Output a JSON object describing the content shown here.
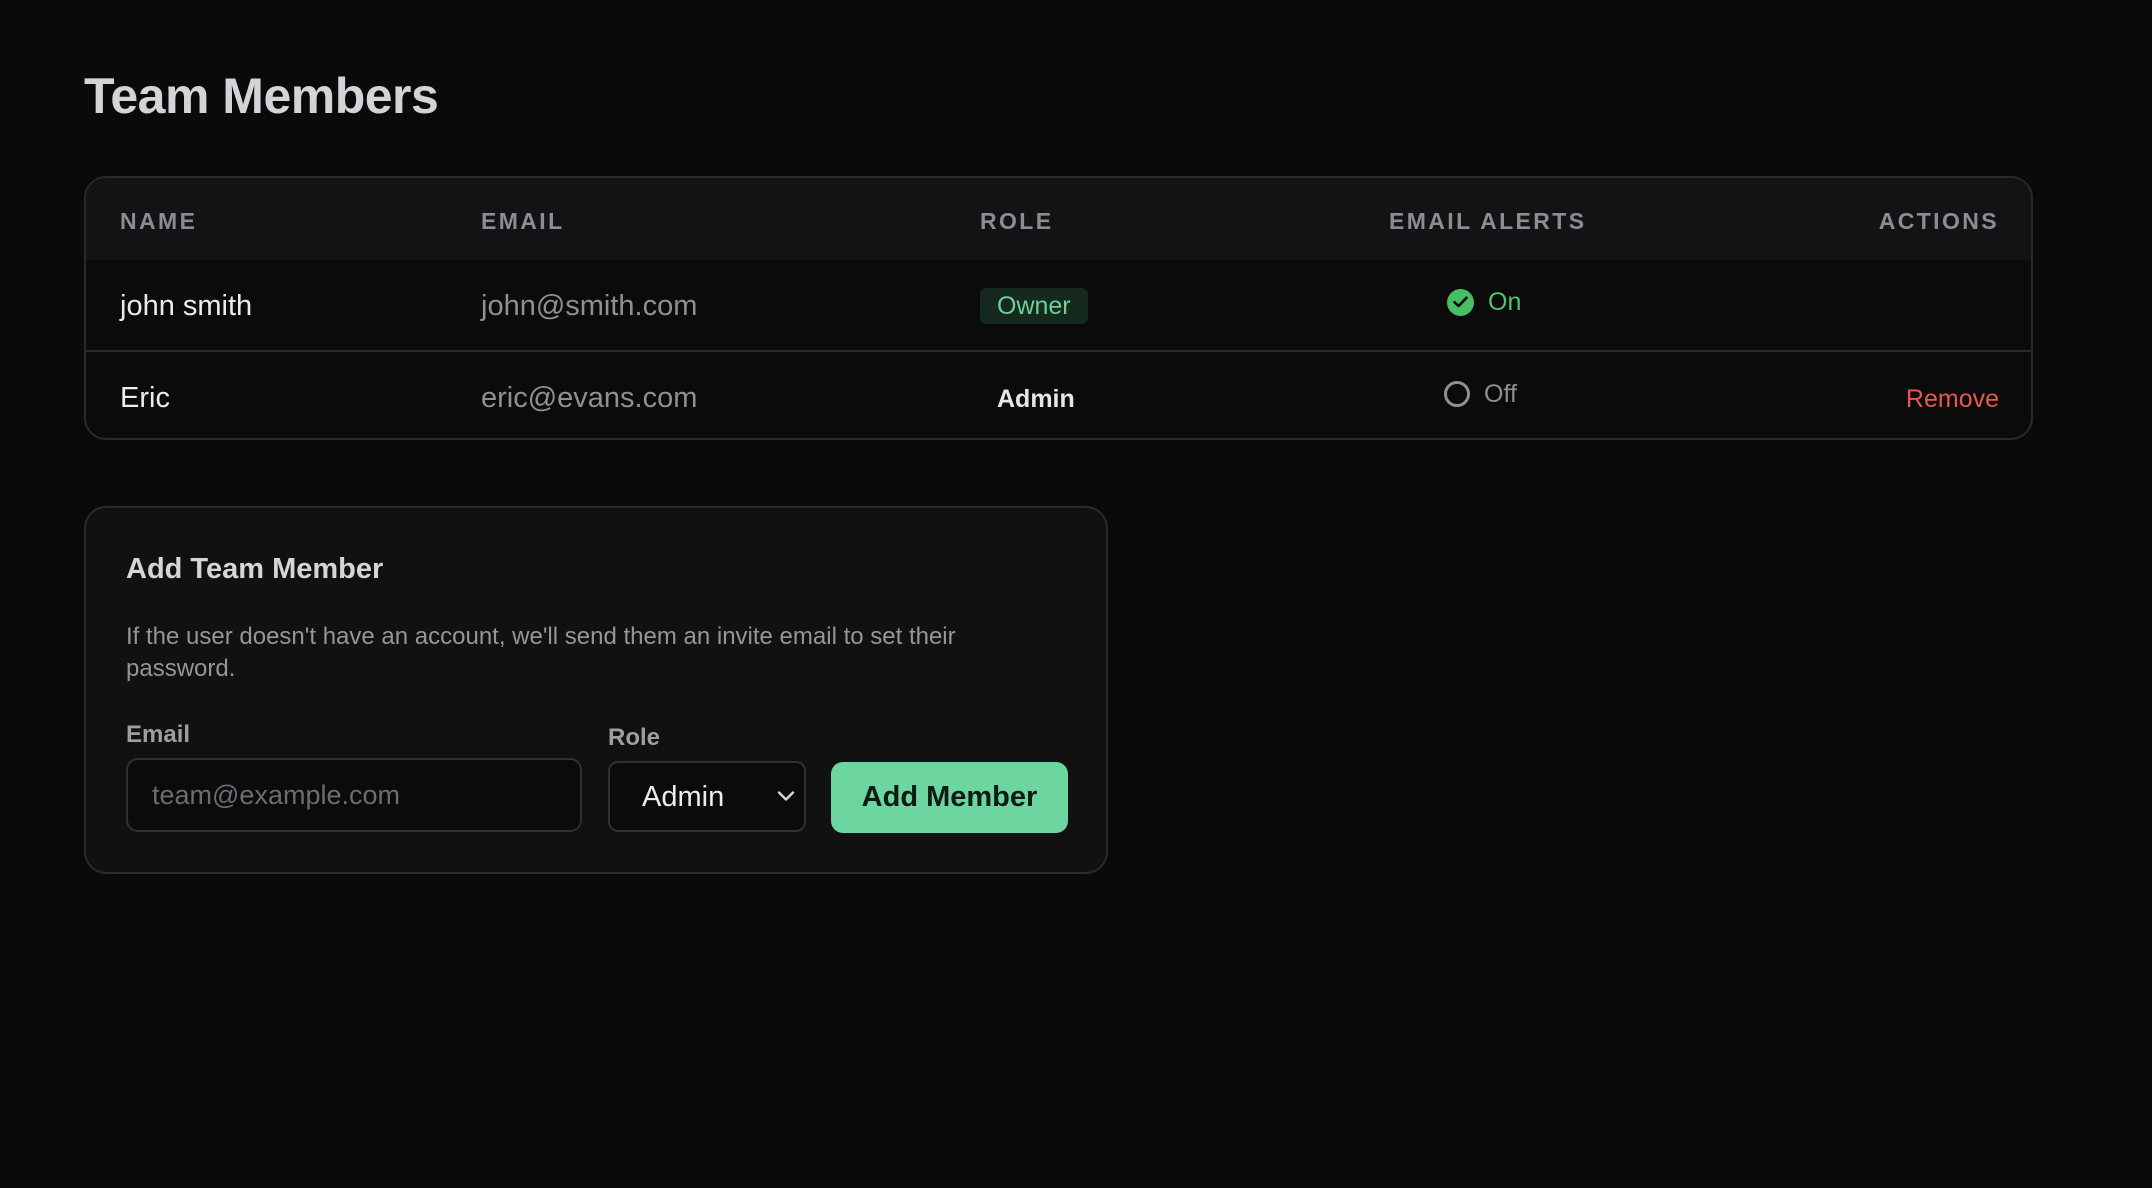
{
  "page": {
    "title": "Team Members"
  },
  "table": {
    "columns": [
      "NAME",
      "EMAIL",
      "ROLE",
      "EMAIL ALERTS",
      "ACTIONS"
    ],
    "rows": [
      {
        "name": "john smith",
        "email": "john@smith.com",
        "role": "Owner",
        "email_alerts": "On",
        "email_alerts_icon": "check-circle-icon",
        "action": ""
      },
      {
        "name": "Eric",
        "email": "eric@evans.com",
        "role": "Admin",
        "email_alerts": "Off",
        "email_alerts_icon": "empty-circle-icon",
        "action": "Remove"
      }
    ]
  },
  "add_member": {
    "title": "Add Team Member",
    "description": "If the user doesn't have an account, we'll send them an invite email to set their password.",
    "email_label": "Email",
    "email_placeholder": "team@example.com",
    "email_value": "",
    "role_label": "Role",
    "role_selected": "Admin",
    "submit_label": "Add Member"
  },
  "colors": {
    "background": "#0a0a0a",
    "accent_green": "#6dd6a0",
    "alert_on": "#46be61",
    "danger": "#e5584f",
    "owner_badge_bg": "#16291f",
    "owner_badge_text": "#6fcf97"
  }
}
